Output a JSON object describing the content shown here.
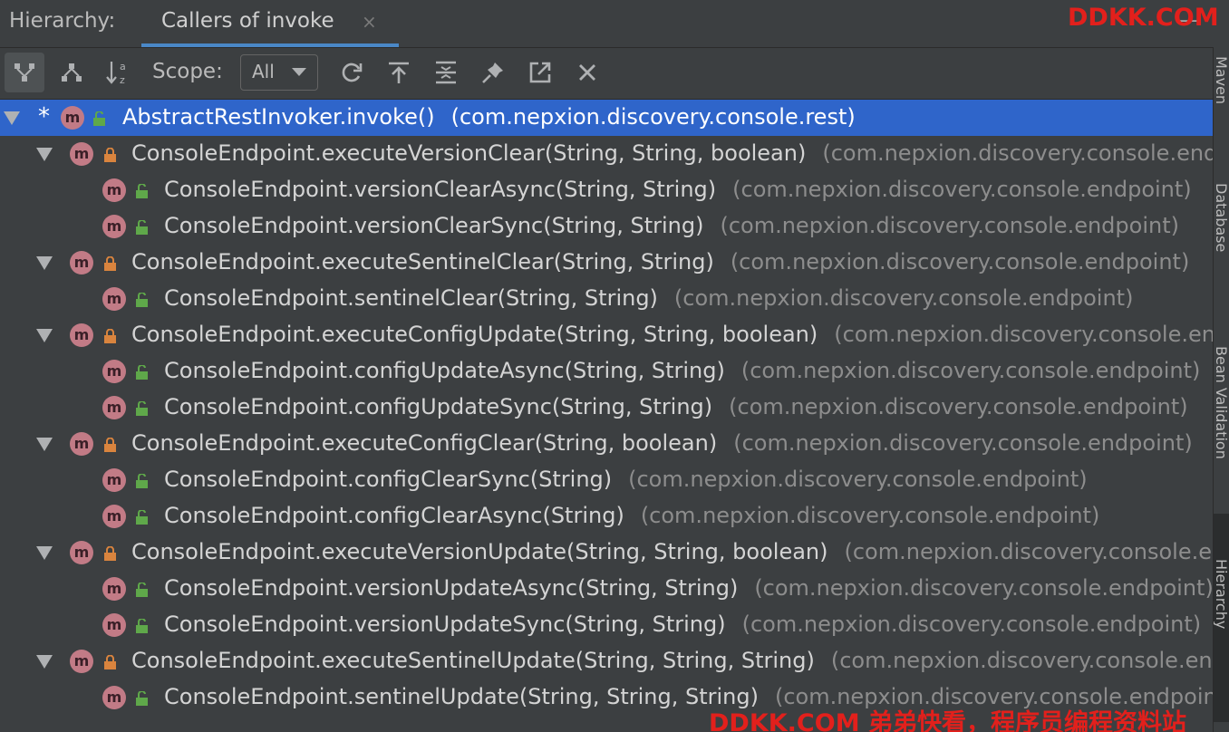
{
  "header": {
    "hierarchy_label": "Hierarchy:",
    "tab_title": "Callers of invoke",
    "tab_close": "×",
    "minimize": "—"
  },
  "watermark": {
    "top": "DDKK.COM",
    "bottom": "DDKK.COM 弟弟快看，程序员编程资料站"
  },
  "toolbar": {
    "buttons": [
      {
        "name": "caller-hierarchy-icon",
        "active": true
      },
      {
        "name": "callee-hierarchy-icon",
        "active": false
      },
      {
        "name": "sort-alphabetically-icon",
        "active": false
      },
      {
        "name": "refresh-icon",
        "active": false
      },
      {
        "name": "export-icon",
        "active": false
      },
      {
        "name": "expand-all-icon",
        "active": false
      },
      {
        "name": "pin-icon",
        "active": false
      },
      {
        "name": "open-in-new-icon",
        "active": false
      },
      {
        "name": "close-icon",
        "active": false
      }
    ],
    "scope_label": "Scope:",
    "scope_value": "All"
  },
  "tree": {
    "rows": [
      {
        "level": 0,
        "expanded": true,
        "star": "*",
        "icon": "m",
        "lock": "open",
        "method": "AbstractRestInvoker.invoke()",
        "package": "(com.nepxion.discovery.console.rest)",
        "selected": true
      },
      {
        "level": 1,
        "expanded": true,
        "icon": "m",
        "lock": "closed",
        "method": "ConsoleEndpoint.executeVersionClear(String, String, boolean)",
        "package": "(com.nepxion.discovery.console.endpoint)"
      },
      {
        "level": 2,
        "icon": "m",
        "lock": "open",
        "method": "ConsoleEndpoint.versionClearAsync(String, String)",
        "package": "(com.nepxion.discovery.console.endpoint)"
      },
      {
        "level": 2,
        "icon": "m",
        "lock": "open",
        "method": "ConsoleEndpoint.versionClearSync(String, String)",
        "package": "(com.nepxion.discovery.console.endpoint)"
      },
      {
        "level": 1,
        "expanded": true,
        "icon": "m",
        "lock": "closed",
        "method": "ConsoleEndpoint.executeSentinelClear(String, String)",
        "package": "(com.nepxion.discovery.console.endpoint)"
      },
      {
        "level": 2,
        "icon": "m",
        "lock": "open",
        "method": "ConsoleEndpoint.sentinelClear(String, String)",
        "package": "(com.nepxion.discovery.console.endpoint)"
      },
      {
        "level": 1,
        "expanded": true,
        "icon": "m",
        "lock": "closed",
        "method": "ConsoleEndpoint.executeConfigUpdate(String, String, boolean)",
        "package": "(com.nepxion.discovery.console.endpoint)"
      },
      {
        "level": 2,
        "icon": "m",
        "lock": "open",
        "method": "ConsoleEndpoint.configUpdateAsync(String, String)",
        "package": "(com.nepxion.discovery.console.endpoint)"
      },
      {
        "level": 2,
        "icon": "m",
        "lock": "open",
        "method": "ConsoleEndpoint.configUpdateSync(String, String)",
        "package": "(com.nepxion.discovery.console.endpoint)"
      },
      {
        "level": 1,
        "expanded": true,
        "icon": "m",
        "lock": "closed",
        "method": "ConsoleEndpoint.executeConfigClear(String, boolean)",
        "package": "(com.nepxion.discovery.console.endpoint)"
      },
      {
        "level": 2,
        "icon": "m",
        "lock": "open",
        "method": "ConsoleEndpoint.configClearSync(String)",
        "package": "(com.nepxion.discovery.console.endpoint)"
      },
      {
        "level": 2,
        "icon": "m",
        "lock": "open",
        "method": "ConsoleEndpoint.configClearAsync(String)",
        "package": "(com.nepxion.discovery.console.endpoint)"
      },
      {
        "level": 1,
        "expanded": true,
        "icon": "m",
        "lock": "closed",
        "method": "ConsoleEndpoint.executeVersionUpdate(String, String, boolean)",
        "package": "(com.nepxion.discovery.console.endpoint)"
      },
      {
        "level": 2,
        "icon": "m",
        "lock": "open",
        "method": "ConsoleEndpoint.versionUpdateAsync(String, String)",
        "package": "(com.nepxion.discovery.console.endpoint)"
      },
      {
        "level": 2,
        "icon": "m",
        "lock": "open",
        "method": "ConsoleEndpoint.versionUpdateSync(String, String)",
        "package": "(com.nepxion.discovery.console.endpoint)"
      },
      {
        "level": 1,
        "expanded": true,
        "icon": "m",
        "lock": "closed",
        "method": "ConsoleEndpoint.executeSentinelUpdate(String, String, String)",
        "package": "(com.nepxion.discovery.console.endpoint)"
      },
      {
        "level": 2,
        "icon": "m",
        "lock": "open",
        "method": "ConsoleEndpoint.sentinelUpdate(String, String, String)",
        "package": "(com.nepxion.discovery.console.endpoint)"
      }
    ]
  },
  "side_strip": {
    "labels": [
      "Maven",
      "Database",
      "Bean Validation",
      "Hierarchy"
    ]
  },
  "colors": {
    "background": "#3c3f41",
    "selection": "#2f65ca",
    "method_icon": "#c27b86",
    "lock_public": "#5fa84a",
    "lock_private": "#d9843e",
    "tab_underline": "#4a88c7",
    "watermark": "#e2201c"
  }
}
